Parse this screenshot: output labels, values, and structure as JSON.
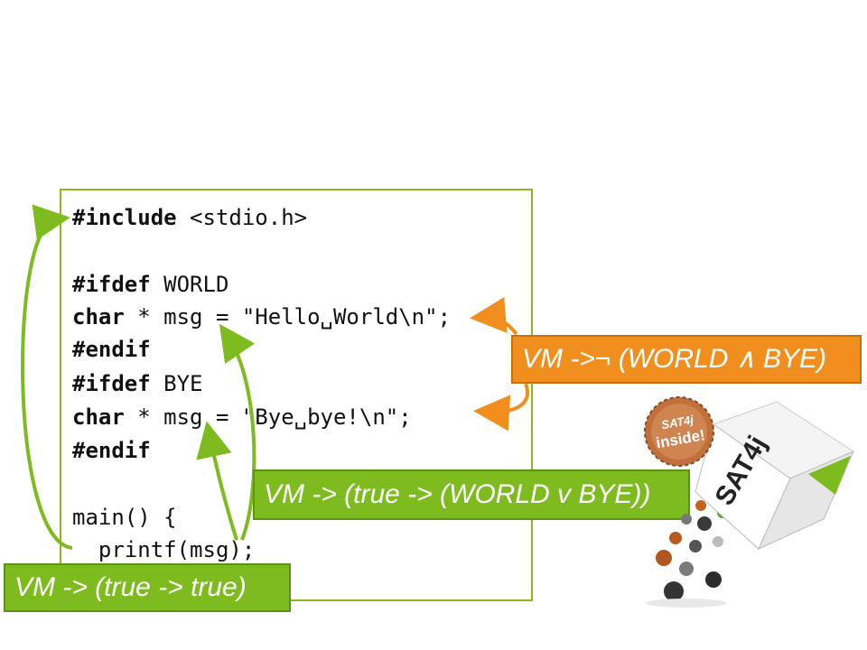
{
  "code": {
    "lines": [
      {
        "keyword": "#include",
        "rest": " <stdio.h>"
      },
      {
        "keyword": "",
        "rest": ""
      },
      {
        "keyword": "#ifdef",
        "rest": " WORLD"
      },
      {
        "keyword": "char",
        "rest": " * msg = \"Hello␣World\\n\";"
      },
      {
        "keyword": "#endif",
        "rest": ""
      },
      {
        "keyword": "#ifdef",
        "rest": " BYE"
      },
      {
        "keyword": "char",
        "rest": " * msg = \"Bye␣bye!\\n\";"
      },
      {
        "keyword": "#endif",
        "rest": ""
      },
      {
        "keyword": "",
        "rest": ""
      },
      {
        "keyword": "",
        "rest": "main() {"
      },
      {
        "keyword": "",
        "rest": "  printf(msg);"
      }
    ]
  },
  "callouts": {
    "orange": "VM ->¬ (WORLD ∧ BYE)",
    "green_middle": "VM -> (true -> (WORLD v BYE))",
    "green_bottom": "VM -> (true -> true)"
  },
  "logo": {
    "badge_line1": "SAT4j",
    "badge_line2": "inside!",
    "box_text": "SAT4j"
  },
  "colors": {
    "green": "#7dbb1e",
    "orange": "#f08e1e",
    "panel_border": "#8cb81e"
  }
}
